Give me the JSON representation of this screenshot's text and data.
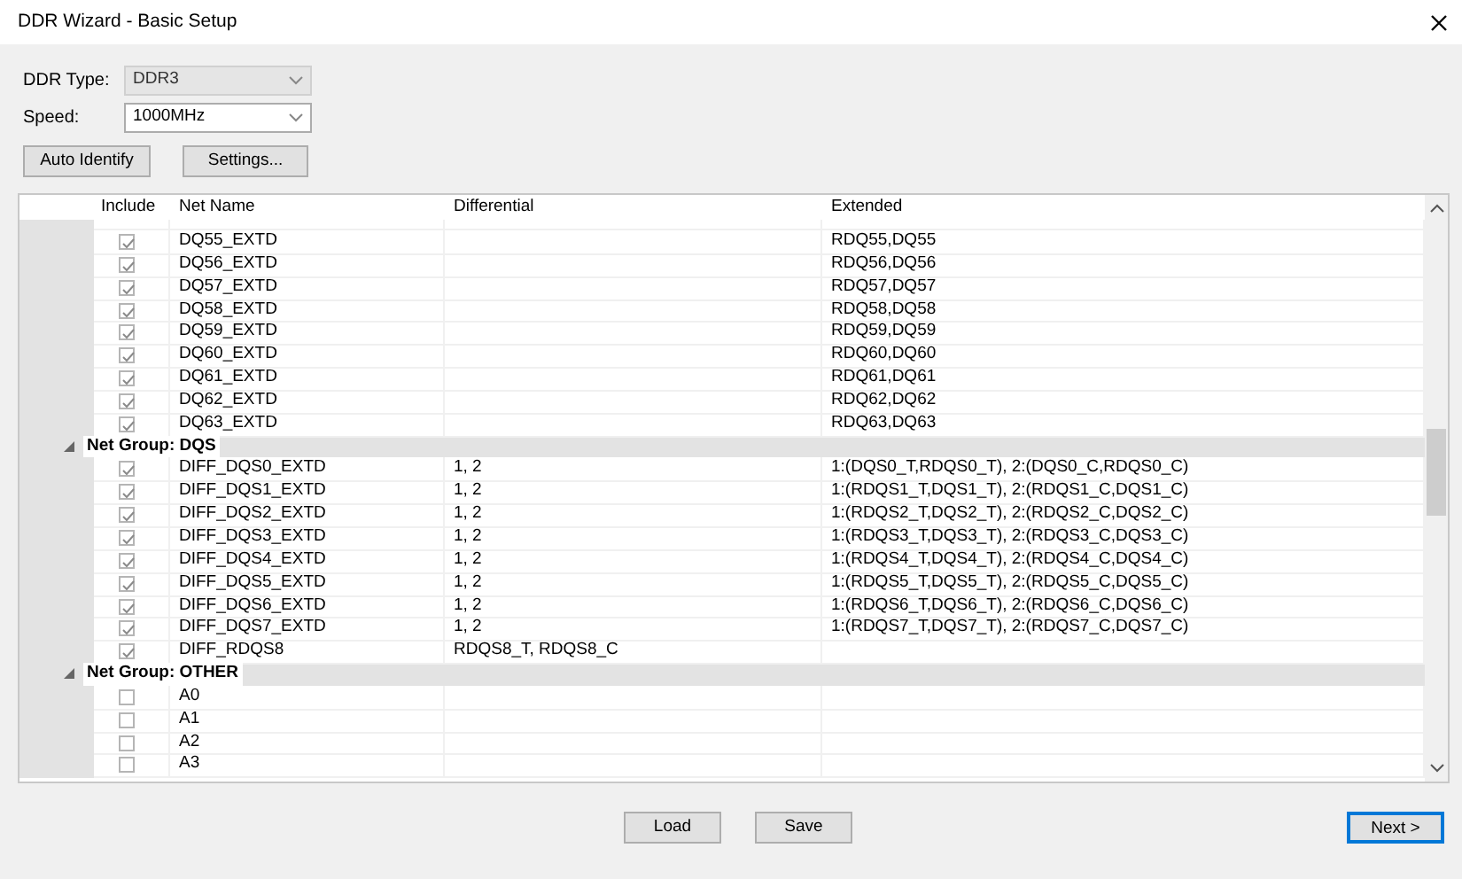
{
  "window": {
    "title": "DDR Wizard - Basic Setup"
  },
  "fields": [
    {
      "label": "DDR Type:",
      "value": "DDR3",
      "disabled": true
    },
    {
      "label": "Speed:",
      "value": "1000MHz",
      "disabled": false
    }
  ],
  "actions": [
    "Auto Identify",
    "Settings..."
  ],
  "table": {
    "columns": [
      "Include",
      "Net Name",
      "Differential",
      "Extended"
    ],
    "rows": [
      {
        "kind": "net",
        "checked": true,
        "net_name": "DQ55_EXTD",
        "extended": "RDQ55,DQ55"
      },
      {
        "kind": "net",
        "checked": true,
        "net_name": "DQ56_EXTD",
        "extended": "RDQ56,DQ56"
      },
      {
        "kind": "net",
        "checked": true,
        "net_name": "DQ57_EXTD",
        "extended": "RDQ57,DQ57"
      },
      {
        "kind": "net",
        "checked": true,
        "net_name": "DQ58_EXTD",
        "extended": "RDQ58,DQ58"
      },
      {
        "kind": "net",
        "checked": true,
        "net_name": "DQ59_EXTD",
        "extended": "RDQ59,DQ59"
      },
      {
        "kind": "net",
        "checked": true,
        "net_name": "DQ60_EXTD",
        "extended": "RDQ60,DQ60"
      },
      {
        "kind": "net",
        "checked": true,
        "net_name": "DQ61_EXTD",
        "extended": "RDQ61,DQ61"
      },
      {
        "kind": "net",
        "checked": true,
        "net_name": "DQ62_EXTD",
        "extended": "RDQ62,DQ62"
      },
      {
        "kind": "net",
        "checked": true,
        "net_name": "DQ63_EXTD",
        "extended": "RDQ63,DQ63"
      },
      {
        "kind": "group",
        "label": "Net Group: DQS",
        "expanded": true
      },
      {
        "kind": "net",
        "checked": true,
        "net_name": "DIFF_DQS0_EXTD",
        "differential": "1, 2",
        "extended": "1:(DQS0_T,RDQS0_T), 2:(DQS0_C,RDQS0_C)"
      },
      {
        "kind": "net",
        "checked": true,
        "net_name": "DIFF_DQS1_EXTD",
        "differential": "1, 2",
        "extended": "1:(RDQS1_T,DQS1_T), 2:(RDQS1_C,DQS1_C)"
      },
      {
        "kind": "net",
        "checked": true,
        "net_name": "DIFF_DQS2_EXTD",
        "differential": "1, 2",
        "extended": "1:(RDQS2_T,DQS2_T), 2:(RDQS2_C,DQS2_C)"
      },
      {
        "kind": "net",
        "checked": true,
        "net_name": "DIFF_DQS3_EXTD",
        "differential": "1, 2",
        "extended": "1:(RDQS3_T,DQS3_T), 2:(RDQS3_C,DQS3_C)"
      },
      {
        "kind": "net",
        "checked": true,
        "net_name": "DIFF_DQS4_EXTD",
        "differential": "1, 2",
        "extended": "1:(RDQS4_T,DQS4_T), 2:(RDQS4_C,DQS4_C)"
      },
      {
        "kind": "net",
        "checked": true,
        "net_name": "DIFF_DQS5_EXTD",
        "differential": "1, 2",
        "extended": "1:(RDQS5_T,DQS5_T), 2:(RDQS5_C,DQS5_C)"
      },
      {
        "kind": "net",
        "checked": true,
        "net_name": "DIFF_DQS6_EXTD",
        "differential": "1, 2",
        "extended": "1:(RDQS6_T,DQS6_T), 2:(RDQS6_C,DQS6_C)"
      },
      {
        "kind": "net",
        "checked": true,
        "net_name": "DIFF_DQS7_EXTD",
        "differential": "1, 2",
        "extended": "1:(RDQS7_T,DQS7_T), 2:(RDQS7_C,DQS7_C)"
      },
      {
        "kind": "net",
        "checked": true,
        "net_name": "DIFF_RDQS8",
        "differential": "RDQS8_T, RDQS8_C"
      },
      {
        "kind": "group",
        "label": "Net Group: OTHER",
        "expanded": true
      },
      {
        "kind": "net",
        "checked": false,
        "net_name": "A0"
      },
      {
        "kind": "net",
        "checked": false,
        "net_name": "A1"
      },
      {
        "kind": "net",
        "checked": false,
        "net_name": "A2"
      },
      {
        "kind": "net",
        "checked": false,
        "net_name": "A3"
      }
    ]
  },
  "footer_buttons": [
    {
      "label": "Load",
      "default": false
    },
    {
      "label": "Save",
      "default": false
    },
    {
      "label": "Next >",
      "default": true
    }
  ]
}
